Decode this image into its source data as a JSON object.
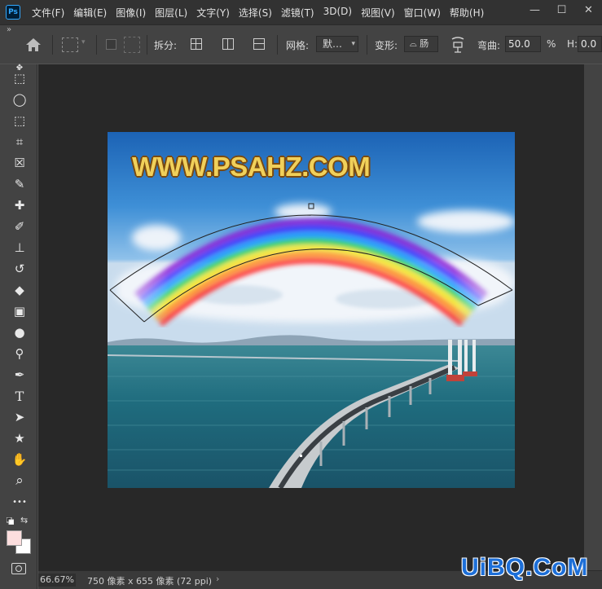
{
  "app": {
    "logo_text": "Ps"
  },
  "menu": [
    "文件(F)",
    "编辑(E)",
    "图像(I)",
    "图层(L)",
    "文字(Y)",
    "选择(S)",
    "滤镜(T)",
    "3D(D)",
    "视图(V)",
    "窗口(W)",
    "帮助(H)"
  ],
  "window_controls": {
    "minimize": "—",
    "maximize": "☐",
    "close": "✕"
  },
  "options": {
    "collapse": "»",
    "split_label": "拆分:",
    "grid_label": "网格:",
    "grid_value": "默…",
    "warp_label": "变形:",
    "warp_value": "⌓ 肠",
    "bend_label": "弯曲:",
    "bend_value": "50.0",
    "bend_unit": "%",
    "h_label": "H:",
    "h_value": "0.0"
  },
  "tools": {
    "move": "✥",
    "marquee": "⬚",
    "lasso": "◯",
    "quick_select": "⬚",
    "crop": "⌗",
    "frame": "☒",
    "eyedropper": "✎",
    "healing": "✚",
    "brush": "✐",
    "stamp": "⊥",
    "history_brush": "↺",
    "eraser": "◆",
    "gradient": "▣",
    "blur": "●",
    "dodge": "⚲",
    "pen": "✒",
    "type": "T",
    "path_select": "➤",
    "shape": "★",
    "hand": "✋",
    "zoom": "⌕",
    "more": "•••",
    "swap": "⇆"
  },
  "colors": {
    "foreground": "#fcdede",
    "background": "#ffffff"
  },
  "canvas": {
    "watermark": "WWW.PSAHZ.COM"
  },
  "status": {
    "zoom": "66.67%",
    "doc_info": "750 像素 x 655 像素 (72 ppi)",
    "arrow": "›"
  },
  "site_logo": "UiBQ.CoM"
}
